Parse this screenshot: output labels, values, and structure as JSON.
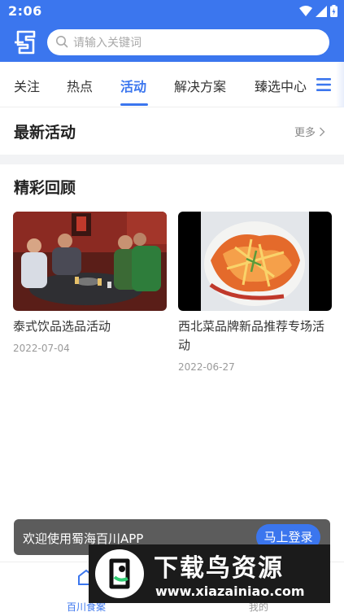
{
  "status_bar": {
    "time": "2:06"
  },
  "search": {
    "placeholder": "请输入关键词"
  },
  "tabs": [
    {
      "label": "关注",
      "active": false
    },
    {
      "label": "热点",
      "active": false
    },
    {
      "label": "活动",
      "active": true
    },
    {
      "label": "解决方案",
      "active": false
    },
    {
      "label": "臻选中心",
      "active": false
    }
  ],
  "latest": {
    "title": "最新活动",
    "more_label": "更多"
  },
  "review": {
    "title": "精彩回顾",
    "items": [
      {
        "title": "泰式饮品选品活动",
        "date": "2022-07-04"
      },
      {
        "title": "西北菜品牌新品推荐专场活动",
        "date": "2022-06-27"
      }
    ]
  },
  "toast": {
    "message": "欢迎使用蜀海百川APP",
    "button": "马上登录"
  },
  "bottom_nav": [
    {
      "label": "百川食案",
      "active": true
    },
    {
      "label": "我的",
      "active": false
    }
  ],
  "watermark": {
    "title": "下载鸟资源",
    "url": "www.xiazainiao.com"
  },
  "colors": {
    "accent": "#3b76ee",
    "toast_bg": "#5c5c5c"
  }
}
